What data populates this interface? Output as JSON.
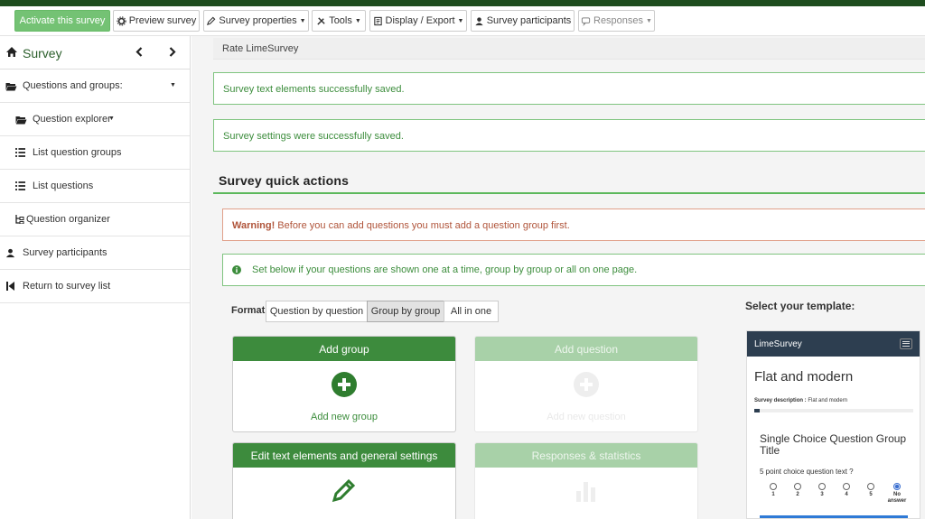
{
  "toolbar": {
    "activate": "Activate this survey",
    "preview": "Preview survey",
    "properties": "Survey properties",
    "tools": "Tools",
    "display_export": "Display / Export",
    "participants": "Survey participants",
    "responses": "Responses"
  },
  "sidebar": {
    "title": "Survey",
    "items": [
      {
        "label": "Questions and groups:",
        "icon": "folder-open-icon"
      },
      {
        "label": "Question explorer",
        "icon": "folder-open-icon"
      },
      {
        "label": "List question groups",
        "icon": "list-icon"
      },
      {
        "label": "List questions",
        "icon": "list-icon"
      },
      {
        "label": "Question organizer",
        "icon": "organizer-icon"
      },
      {
        "label": "Survey participants",
        "icon": "user-icon"
      },
      {
        "label": "Return to survey list",
        "icon": "step-backward-icon"
      }
    ]
  },
  "main": {
    "breadcrumb": "Rate LimeSurvey",
    "alert_text_saved": "Survey text elements successfully saved.",
    "alert_settings_saved": "Survey settings were successfully saved.",
    "quick_actions_title": "Survey quick actions",
    "warning_strong": "Warning!",
    "warning_text": " Before you can add questions you must add a question group first.",
    "info_text": "Set below if your questions are shown one at a time, group by group or all on one page.",
    "format_label": "Format:",
    "format_options": [
      "Question by question",
      "Group by group",
      "All in one"
    ],
    "format_selected": "Group by group",
    "cards": {
      "add_group": {
        "title": "Add group",
        "sub": "Add new group"
      },
      "add_question": {
        "title": "Add question",
        "sub": "Add new question"
      },
      "edit_text": {
        "title": "Edit text elements and general settings"
      },
      "responses_stats": {
        "title": "Responses & statistics"
      }
    },
    "template_label": "Select your template:",
    "template": {
      "brand": "LimeSurvey",
      "name": "Flat and modern",
      "desc_label": "Survey description :",
      "desc_value": " Flat and modern",
      "group_title": "Single Choice Question Group Title",
      "question_text": "5 point choice question text ?",
      "options": [
        "1",
        "2",
        "3",
        "4",
        "5",
        "No answer"
      ],
      "selected": "No answer"
    }
  },
  "colors": {
    "accent_green": "#3d8b3d",
    "top_strip": "#1e4d1e",
    "alert_green": "#3c8d3c",
    "warning": "#b0543a",
    "template_nav": "#2d3e50"
  }
}
